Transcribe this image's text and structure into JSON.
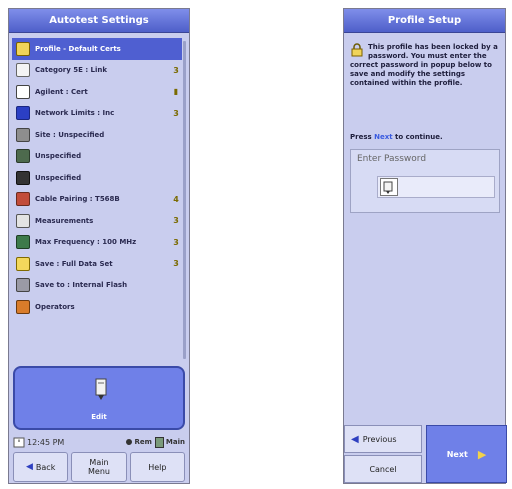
{
  "colors": {
    "title_bar": "#4e5fc9",
    "panel_bg": "#c9cdee",
    "selected_row": "#4f5fd1",
    "accent_button": "#6f80e8"
  },
  "left": {
    "title": "Autotest Settings",
    "items": [
      {
        "label": "Profile - Default Certs",
        "icon": "padlock-icon",
        "indicator": "",
        "selected": true
      },
      {
        "label": "Category 5E : Link",
        "icon": "document-icon",
        "indicator": "3"
      },
      {
        "label": "Agilent : Cert",
        "icon": "agilent-icon",
        "indicator": "▮"
      },
      {
        "label": "Network Limits : Inc",
        "icon": "network-limits-icon",
        "indicator": "3"
      },
      {
        "label": "Site : Unspecified",
        "icon": "building-icon",
        "indicator": ""
      },
      {
        "label": "Unspecified",
        "icon": "technician-icon",
        "indicator": ""
      },
      {
        "label": "Unspecified",
        "icon": "tester-icon",
        "indicator": ""
      },
      {
        "label": "Cable Pairing : T568B",
        "icon": "cable-pairing-icon",
        "indicator": "4"
      },
      {
        "label": "Measurements",
        "icon": "measurements-icon",
        "indicator": "3"
      },
      {
        "label": "Max Frequency : 100 MHz",
        "icon": "frequency-icon",
        "indicator": "3"
      },
      {
        "label": "Save : Full Data Set",
        "icon": "save-icon",
        "indicator": "3"
      },
      {
        "label": "Save to : Internal Flash",
        "icon": "storage-icon",
        "indicator": ""
      },
      {
        "label": "Operators",
        "icon": "operators-icon",
        "indicator": ""
      }
    ],
    "edit_label": "Edit",
    "status": {
      "time": "12:45 PM",
      "remote": "Rem",
      "main": "Main"
    },
    "buttons": {
      "back": "Back",
      "main_menu": "Main Menu",
      "help": "Help"
    }
  },
  "right": {
    "title": "Profile Setup",
    "message": "This profile has been locked by a password. You must enter the correct password in popup below to save and modify the settings contained within the profile.",
    "continue_pre": "Press",
    "continue_next": "Next",
    "continue_post": "to continue.",
    "password_placeholder": "Enter Password",
    "buttons": {
      "previous": "Previous",
      "cancel": "Cancel",
      "next": "Next"
    }
  }
}
